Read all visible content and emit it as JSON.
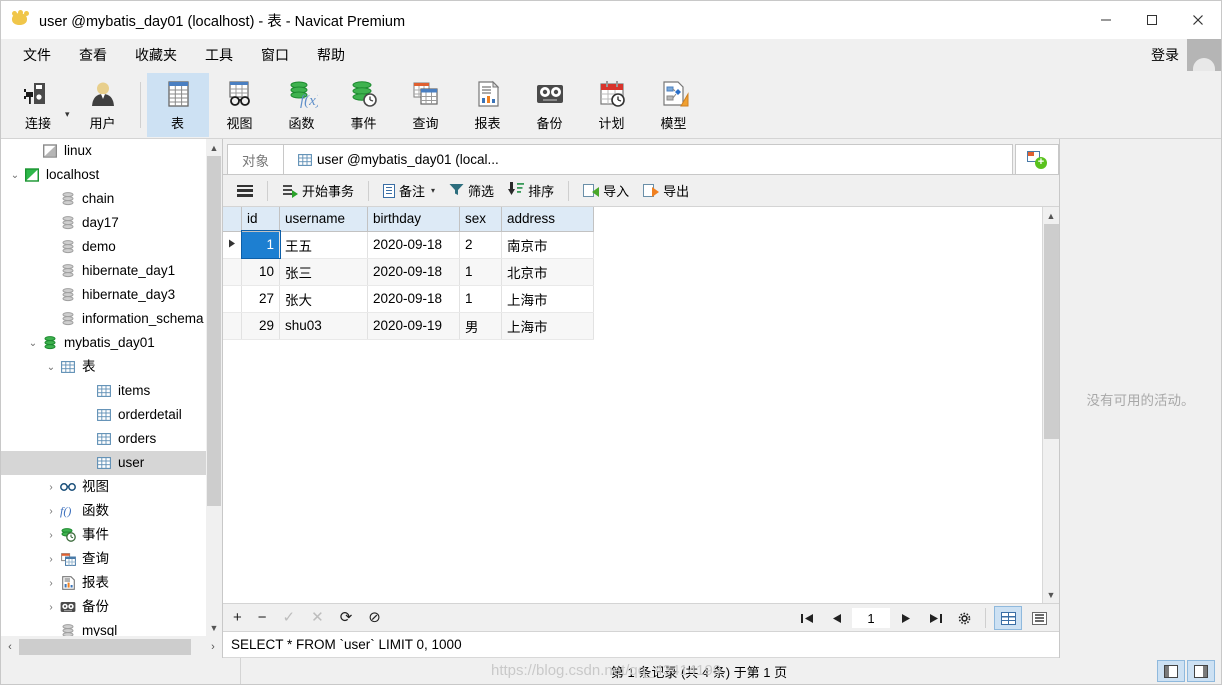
{
  "window": {
    "title": "user @mybatis_day01 (localhost) - 表 - Navicat Premium",
    "app_icon": "paw-icon",
    "minimize": "–",
    "maximize": "□",
    "close": "✕"
  },
  "menubar": {
    "items": [
      {
        "label": "文件",
        "name": "menu-file"
      },
      {
        "label": "查看",
        "name": "menu-view"
      },
      {
        "label": "收藏夹",
        "name": "menu-favorites"
      },
      {
        "label": "工具",
        "name": "menu-tools"
      },
      {
        "label": "窗口",
        "name": "menu-window"
      },
      {
        "label": "帮助",
        "name": "menu-help"
      }
    ],
    "login_label": "登录"
  },
  "toolbar": {
    "items": [
      {
        "label": "连接",
        "icon": "connection-icon",
        "active": false,
        "has_caret": true
      },
      {
        "label": "用户",
        "icon": "user-icon",
        "active": false
      },
      {
        "label": "表",
        "icon": "table-icon",
        "active": true
      },
      {
        "label": "视图",
        "icon": "view-icon",
        "active": false
      },
      {
        "label": "函数",
        "icon": "function-icon",
        "active": false
      },
      {
        "label": "事件",
        "icon": "event-icon",
        "active": false
      },
      {
        "label": "查询",
        "icon": "query-icon",
        "active": false
      },
      {
        "label": "报表",
        "icon": "report-icon",
        "active": false
      },
      {
        "label": "备份",
        "icon": "backup-icon",
        "active": false
      },
      {
        "label": "计划",
        "icon": "schedule-icon",
        "active": false
      },
      {
        "label": "模型",
        "icon": "model-icon",
        "active": false
      }
    ]
  },
  "sidebar": {
    "nodes": [
      {
        "label": "linux",
        "icon": "connection-grey-icon",
        "indent": 1,
        "twist": "",
        "selected": false
      },
      {
        "label": "localhost",
        "icon": "connection-green-icon",
        "indent": 0,
        "twist": "expanded",
        "selected": false
      },
      {
        "label": "chain",
        "icon": "database-icon",
        "indent": 2,
        "twist": "",
        "selected": false
      },
      {
        "label": "day17",
        "icon": "database-icon",
        "indent": 2,
        "twist": "",
        "selected": false
      },
      {
        "label": "demo",
        "icon": "database-icon",
        "indent": 2,
        "twist": "",
        "selected": false
      },
      {
        "label": "hibernate_day1",
        "icon": "database-icon",
        "indent": 2,
        "twist": "",
        "selected": false
      },
      {
        "label": "hibernate_day3",
        "icon": "database-icon",
        "indent": 2,
        "twist": "",
        "selected": false
      },
      {
        "label": "information_schema",
        "icon": "database-icon",
        "indent": 2,
        "twist": "",
        "selected": false
      },
      {
        "label": "mybatis_day01",
        "icon": "database-green-icon",
        "indent": 1,
        "twist": "expanded",
        "selected": false
      },
      {
        "label": "表",
        "icon": "table-grid-icon",
        "indent": 2,
        "twist": "expanded",
        "selected": false
      },
      {
        "label": "items",
        "icon": "table-grid-icon",
        "indent": 4,
        "twist": "",
        "selected": false
      },
      {
        "label": "orderdetail",
        "icon": "table-grid-icon",
        "indent": 4,
        "twist": "",
        "selected": false
      },
      {
        "label": "orders",
        "icon": "table-grid-icon",
        "indent": 4,
        "twist": "",
        "selected": false
      },
      {
        "label": "user",
        "icon": "table-grid-icon",
        "indent": 4,
        "twist": "",
        "selected": true
      },
      {
        "label": "视图",
        "icon": "view-glasses-icon",
        "indent": 2,
        "twist": "collapsed",
        "selected": false
      },
      {
        "label": "函数",
        "icon": "function-fx-icon",
        "indent": 2,
        "twist": "collapsed",
        "selected": false
      },
      {
        "label": "事件",
        "icon": "event-clock-icon",
        "indent": 2,
        "twist": "collapsed",
        "selected": false
      },
      {
        "label": "查询",
        "icon": "query-icon",
        "indent": 2,
        "twist": "collapsed",
        "selected": false
      },
      {
        "label": "报表",
        "icon": "report-icon",
        "indent": 2,
        "twist": "collapsed",
        "selected": false
      },
      {
        "label": "备份",
        "icon": "backup-icon",
        "indent": 2,
        "twist": "collapsed",
        "selected": false
      },
      {
        "label": "mysql",
        "icon": "database-icon",
        "indent": 2,
        "twist": "",
        "selected": false
      }
    ]
  },
  "tabs": {
    "object_tab": "对象",
    "active_tab": "user @mybatis_day01 (local...",
    "new_query_icon": "new-query-icon"
  },
  "gridtoolbar": {
    "menu_icon": "hamburger-icon",
    "buttons": [
      {
        "label": "开始事务",
        "icon": "begin-transaction-icon",
        "caret": false
      },
      {
        "label": "备注",
        "icon": "note-icon",
        "caret": true
      },
      {
        "label": "筛选",
        "icon": "filter-icon",
        "caret": false
      },
      {
        "label": "排序",
        "icon": "sort-icon",
        "caret": false
      },
      {
        "label": "导入",
        "icon": "import-icon",
        "caret": false
      },
      {
        "label": "导出",
        "icon": "export-icon",
        "caret": false
      }
    ]
  },
  "grid": {
    "columns": [
      "id",
      "username",
      "birthday",
      "sex",
      "address"
    ],
    "rows": [
      {
        "id": "1",
        "username": "王五",
        "birthday": "2020-09-18",
        "sex": "2",
        "address": "南京市",
        "current": true
      },
      {
        "id": "10",
        "username": "张三",
        "birthday": "2020-09-18",
        "sex": "1",
        "address": "北京市",
        "current": false
      },
      {
        "id": "27",
        "username": "张大",
        "birthday": "2020-09-18",
        "sex": "1",
        "address": "上海市",
        "current": false
      },
      {
        "id": "29",
        "username": "shu03",
        "birthday": "2020-09-19",
        "sex": "男",
        "address": "上海市",
        "current": false
      }
    ]
  },
  "editbar": {
    "add": "+",
    "remove": "−",
    "confirm": "✓",
    "cancel": "✕",
    "refresh": "⟳",
    "stop": "⊘",
    "nav": {
      "first": "⏮",
      "prev": "←",
      "page": "1",
      "next": "→",
      "last": "⏭",
      "settings": "⚙"
    },
    "view_grid_icon": "grid-view-icon",
    "view_form_icon": "form-view-icon"
  },
  "sqlbar": {
    "query": "SELECT * FROM `user` LIMIT 0, 1000"
  },
  "statusbar": {
    "record_status": "第 1 条记录 (共 4 条) 于第 1 页",
    "watermark": "https://blog.csdn.net/qq_43414199",
    "panel_left_icon": "panel-left-icon",
    "panel_right_icon": "panel-right-icon"
  },
  "rightpanel": {
    "empty_message": "没有可用的活动。"
  },
  "colors": {
    "accent_blue": "#1d7fd1",
    "header_blue": "#ddeaf6",
    "active_tool": "#cde1f3",
    "chrome": "#f0f0f0"
  }
}
